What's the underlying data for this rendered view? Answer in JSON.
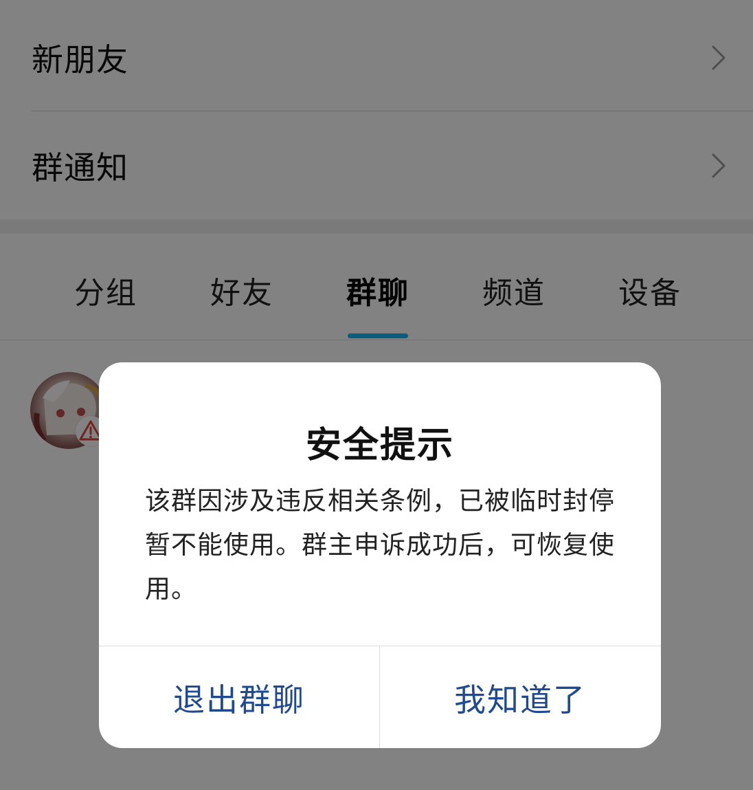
{
  "contacts": {
    "entries": [
      {
        "label": "新朋友"
      },
      {
        "label": "群通知"
      }
    ],
    "tabs": [
      {
        "label": "分组"
      },
      {
        "label": "好友"
      },
      {
        "label": "群聊",
        "active": true
      },
      {
        "label": "频道"
      },
      {
        "label": "设备"
      }
    ],
    "active_tab": "群聊"
  },
  "dialog": {
    "title": "安全提示",
    "message": "该群因涉及违反相关条例，已被临时封停暂不能使用。群主申诉成功后，可恢复使用。",
    "buttons": {
      "exit_label": "退出群聊",
      "ok_label": "我知道了"
    }
  },
  "colors": {
    "accent": "#12b7f5",
    "dialog_button_text": "#1f4a8f",
    "warning": "#e0453a"
  },
  "icons": {
    "entry_chevron": "chevron-right-icon",
    "avatar_badge": "warning-icon"
  }
}
